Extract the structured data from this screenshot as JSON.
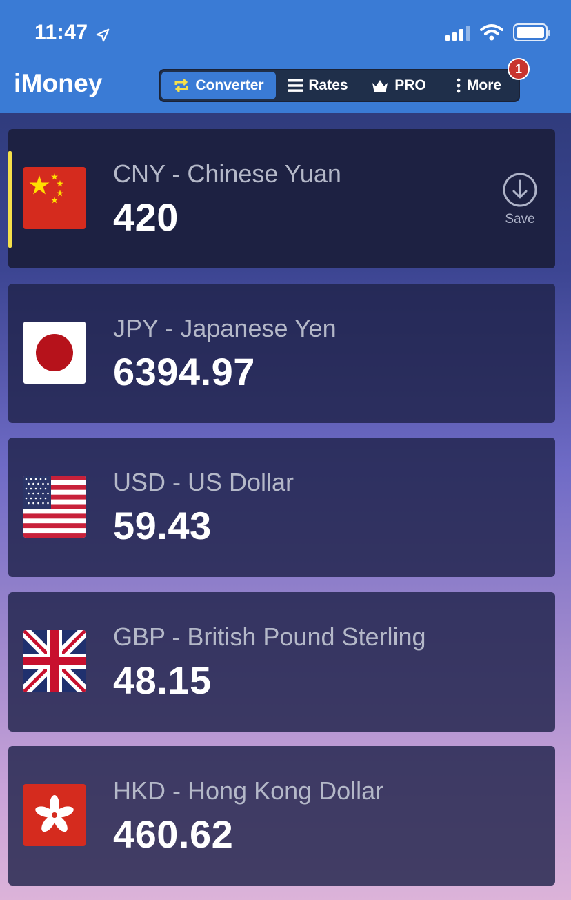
{
  "status_bar": {
    "time": "11:47"
  },
  "app": {
    "title": "iMoney"
  },
  "tabs": [
    {
      "label": "Converter",
      "icon": "repeat-icon",
      "active": true
    },
    {
      "label": "Rates",
      "icon": "list-icon"
    },
    {
      "label": "PRO",
      "icon": "crown-icon"
    },
    {
      "label": "More",
      "icon": "more-vertical-icon",
      "badge": "1"
    }
  ],
  "currencies": [
    {
      "name": "CNY - Chinese Yuan",
      "value": "420",
      "flag": "china-flag-icon",
      "selected": true
    },
    {
      "name": "JPY - Japanese Yen",
      "value": "6394.97",
      "flag": "japan-flag-icon"
    },
    {
      "name": "USD - US Dollar",
      "value": "59.43",
      "flag": "usa-flag-icon"
    },
    {
      "name": "GBP - British Pound Sterling",
      "value": "48.15",
      "flag": "uk-flag-icon"
    },
    {
      "name": "HKD - Hong Kong Dollar",
      "value": "460.62",
      "flag": "hong-kong-flag-icon"
    }
  ],
  "save": {
    "label": "Save"
  },
  "colors": {
    "header": "#3a7bd5",
    "accent": "#f5e04a",
    "badge": "#c8342f"
  }
}
